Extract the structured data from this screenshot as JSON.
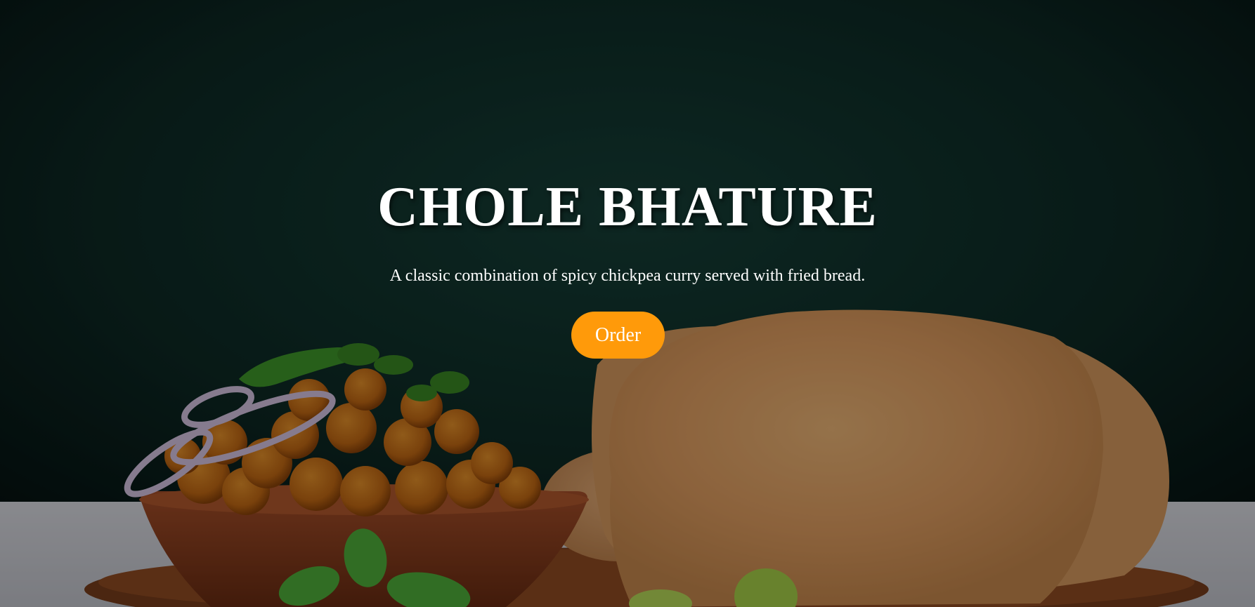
{
  "hero": {
    "title": "CHOLE BHATURE",
    "subtitle": "A classic combination of spicy chickpea curry served with fried bread.",
    "order_label": "Order"
  },
  "colors": {
    "background": "#0c2420",
    "button": "#ff9a0a",
    "text": "#ffffff"
  },
  "images": {
    "hero_image": "chole-bhature-food-photo"
  }
}
